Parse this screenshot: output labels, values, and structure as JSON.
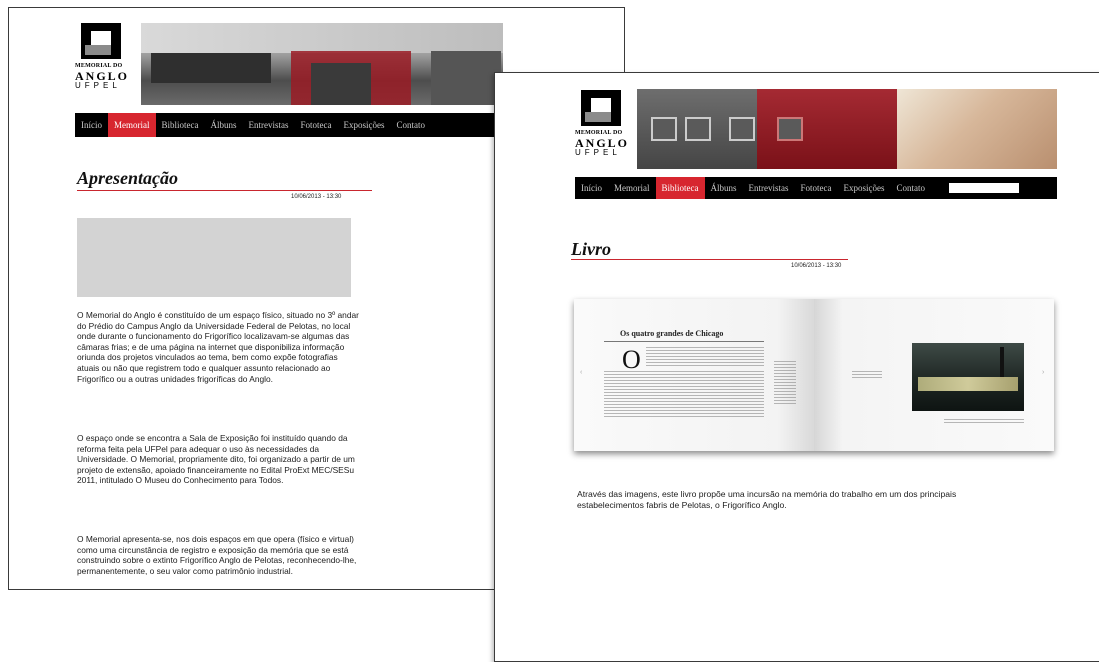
{
  "page1": {
    "logo": {
      "line1": "MEMORIAL DO",
      "line2": "ANGLO",
      "line3": "UFPEL"
    },
    "nav": [
      "Início",
      "Memorial",
      "Biblioteca",
      "Álbuns",
      "Entrevistas",
      "Fototeca",
      "Exposições",
      "Contato"
    ],
    "active_nav": "Memorial",
    "title": "Apresentação",
    "date": "10/06/2013 - 13:30",
    "paragraphs": [
      "O Memorial do Anglo é constituído de um espaço físico, situado no 3º andar do Prédio do Campus Anglo da Universidade Federal de Pelotas, no local onde durante o funcionamento do Frigorífico localizavam-se algumas das câmaras frias; e de uma página na internet que disponibiliza informação oriunda dos projetos vinculados ao tema, bem como expõe fotografias atuais ou não que registrem todo e qualquer assunto relacionado ao Frigorífico ou a outras unidades frigoríficas do Anglo.",
      "O espaço onde se encontra a Sala de Exposição foi instituído quando da reforma feita pela UFPel para adequar o uso às necessidades da Universidade. O Memorial, propriamente dito, foi organizado a partir de um projeto de extensão, apoiado financeiramente no Edital ProExt MEC/SESu 2011, intitulado O Museu do Conhecimento para Todos.",
      "O Memorial apresenta-se, nos dois espaços em que opera (físico e virtual) como uma circunstância de registro e exposição da memória que se está construindo sobre o extinto Frigorífico Anglo de Pelotas, reconhecendo-lhe, permanentemente, o seu valor como patrimônio industrial."
    ]
  },
  "page2": {
    "logo": {
      "line1": "MEMORIAL DO",
      "line2": "ANGLO",
      "line3": "UFPEL"
    },
    "nav": [
      "Início",
      "Memorial",
      "Biblioteca",
      "Álbuns",
      "Entrevistas",
      "Fototeca",
      "Exposições",
      "Contato"
    ],
    "active_nav": "Biblioteca",
    "search_placeholder": "",
    "title": "Livro",
    "date": "10/06/2013 - 13:30",
    "book": {
      "heading": "Os quatro grandes de Chicago",
      "dropcap": "O"
    },
    "caption": "Através das imagens, este livro propõe uma incursão na memória do trabalho em um dos principais estabelecimentos fabris de Pelotas, o Frigorífico Anglo."
  },
  "colors": {
    "accent_red": "#d7262f",
    "nav_bg": "#000000",
    "rule_red": "#c9262e"
  }
}
